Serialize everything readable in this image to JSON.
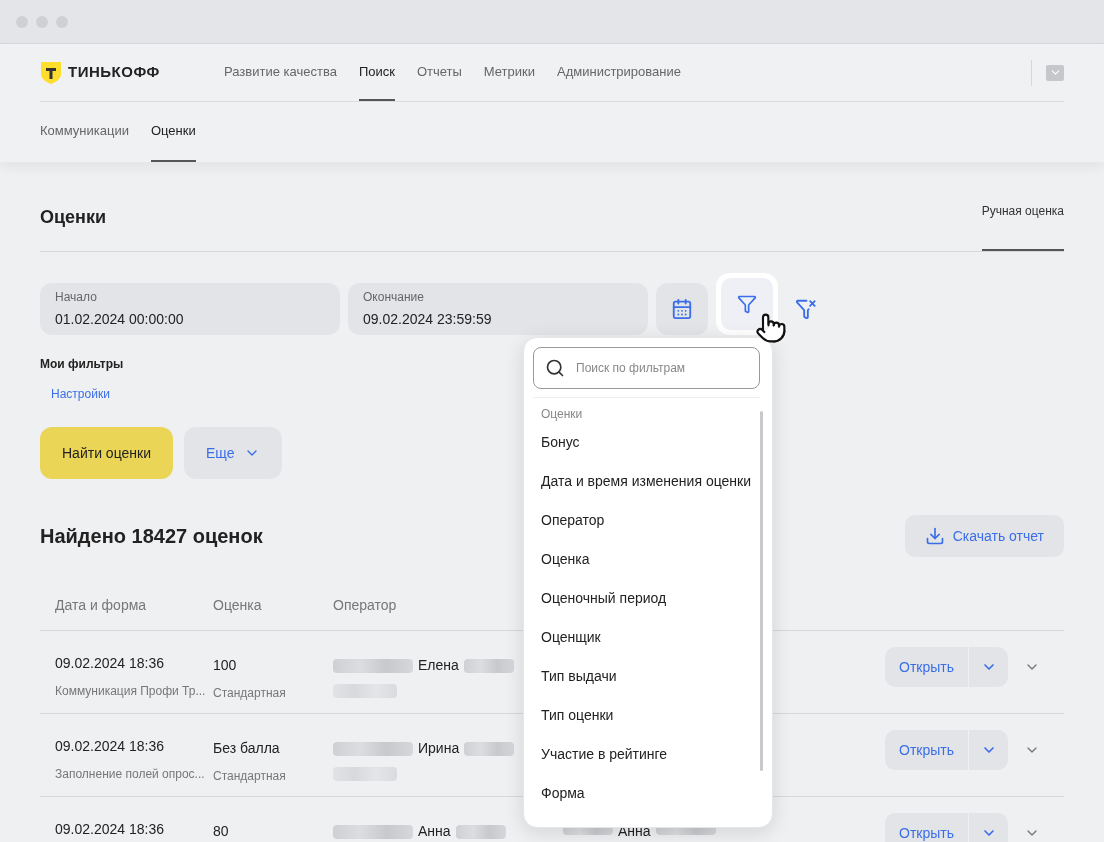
{
  "header": {
    "logo": "ТИНЬКОФФ",
    "nav": [
      {
        "label": "Развитие качества",
        "selected": false
      },
      {
        "label": "Поиск",
        "selected": true
      },
      {
        "label": "Отчеты",
        "selected": false
      },
      {
        "label": "Метрики",
        "selected": false
      },
      {
        "label": "Администрирование",
        "selected": false
      }
    ],
    "subnav": [
      {
        "label": "Коммуникации",
        "selected": false
      },
      {
        "label": "Оценки",
        "selected": true
      }
    ]
  },
  "page": {
    "title": "Оценки",
    "tabs": [
      {
        "label": "Ручная оценка",
        "selected": true
      }
    ]
  },
  "date_fields": [
    {
      "label": "Начало",
      "value": "01.02.2024 00:00:00"
    },
    {
      "label": "Окончание",
      "value": "09.02.2024 23:59:59"
    }
  ],
  "filter_button": {
    "selected": true
  },
  "my_filters": {
    "title": "Мои фильтры",
    "link": "Настройки"
  },
  "actions": {
    "find": "Найти оценки",
    "more": "Еще"
  },
  "results": {
    "title": "Найдено 18427 оценок",
    "download": "Скачать отчет"
  },
  "table": {
    "columns": [
      "Дата и форма",
      "Оценка",
      "Оператор"
    ],
    "rows": [
      {
        "date": "09.02.2024 18:36",
        "form": "Коммуникация Профи Тр...",
        "score": "100",
        "score_type": "Стандартная",
        "operator": "Елена",
        "column_4": "",
        "action": "Открыть"
      },
      {
        "date": "09.02.2024 18:36",
        "form": "Заполнение полей опрос...",
        "score": "Без балла",
        "score_type": "Стандартная",
        "operator": "Ирина",
        "column_4": "",
        "action": "Открыть"
      },
      {
        "date": "09.02.2024 18:36",
        "score": "80",
        "operator": "Анна",
        "column_4": "Анна",
        "action": "Открыть"
      }
    ]
  },
  "filter_menu": {
    "placeholder": "Поиск по фильтрам",
    "group": "Оценки",
    "items": [
      "Бонус",
      "Дата и время изменения оценки",
      "Оператор",
      "Оценка",
      "Оценочный период",
      "Оценщик",
      "Тип выдачи",
      "Тип оценки",
      "Участие в рейтинге",
      "Форма"
    ]
  }
}
